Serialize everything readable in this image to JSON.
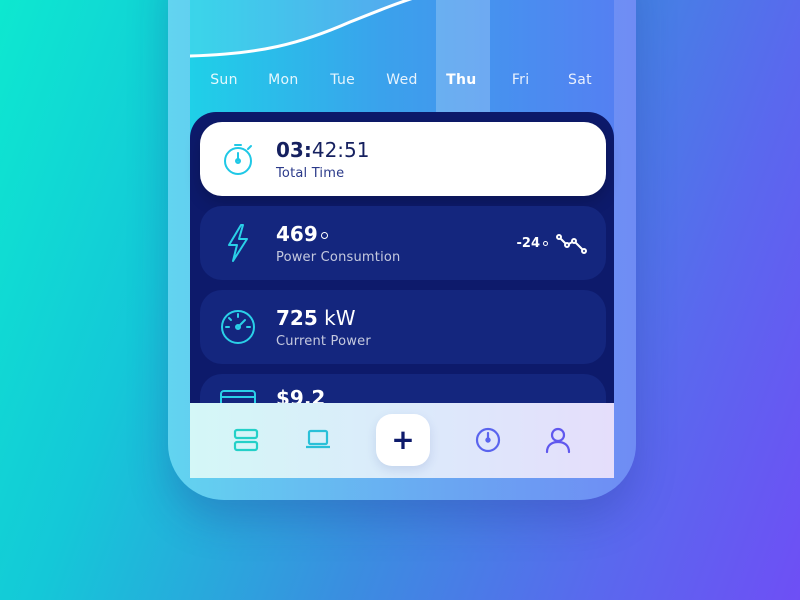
{
  "colors": {
    "accent": "#1fc8e6",
    "panel": "#0d1a6b",
    "card": "#14267e",
    "nav_icon_left": "#24d0c8",
    "nav_icon_right": "#5a64ee"
  },
  "days": [
    {
      "label": "Sun",
      "active": false
    },
    {
      "label": "Mon",
      "active": false
    },
    {
      "label": "Tue",
      "active": false
    },
    {
      "label": "Wed",
      "active": false
    },
    {
      "label": "Thu",
      "active": true
    },
    {
      "label": "Fri",
      "active": false
    },
    {
      "label": "Sat",
      "active": false
    }
  ],
  "cards": {
    "total_time": {
      "hours": "03:",
      "rest": "42:51",
      "label": "Total Time",
      "icon": "stopwatch-icon"
    },
    "power_consumption": {
      "value": "469",
      "label": "Power Consumtion",
      "delta": "-24",
      "icon": "lightning-icon",
      "trend_icon": "trend-line-icon"
    },
    "current_power": {
      "value": "725",
      "unit": "kW",
      "label": "Current Power",
      "icon": "speedometer-icon"
    },
    "cost": {
      "value": "$9.2",
      "icon": "credit-card-icon"
    }
  },
  "bottom_nav": {
    "items": [
      "list-icon",
      "laptop-icon",
      "plus-icon",
      "clock-icon",
      "user-icon"
    ],
    "plus_label": "+"
  }
}
